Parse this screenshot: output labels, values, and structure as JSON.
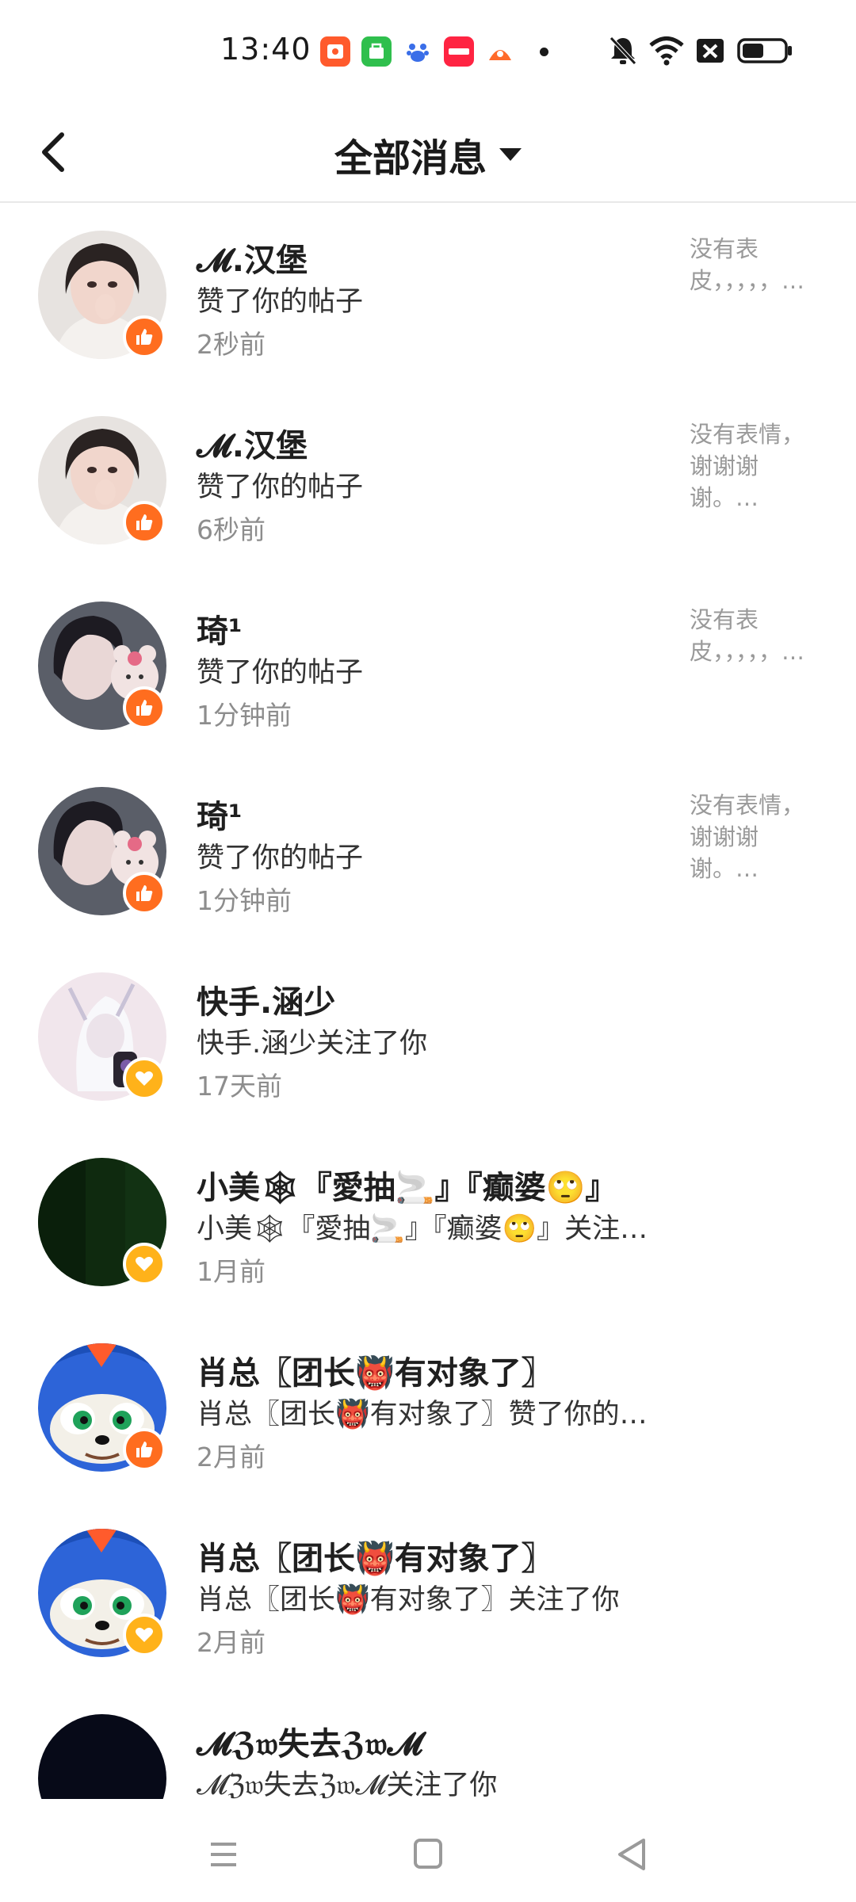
{
  "status_bar": {
    "time": "13:40",
    "notification_icons": [
      {
        "name": "kuaishou-app-icon",
        "color": "#ff5a2c",
        "text": "⊕"
      },
      {
        "name": "shopping-app-icon",
        "color": "#2fbf4d",
        "text": "✓"
      },
      {
        "name": "baidu-app-icon",
        "color": "#ffffff",
        "text": "du"
      },
      {
        "name": "xiaohongshu-app-icon",
        "color": "#ff2442",
        "text": "小红书"
      },
      {
        "name": "game-app-icon",
        "color": "#ff6a2a",
        "text": "●"
      }
    ],
    "battery_level": 0.45
  },
  "header": {
    "title": "全部消息"
  },
  "messages": [
    {
      "name": "𝓜.汉堡",
      "action": "赞了你的帖子",
      "time": "2秒前",
      "preview": "没有表皮，，，，，…",
      "badge": "like",
      "avatar": "girl-1"
    },
    {
      "name": "𝓜.汉堡",
      "action": "赞了你的帖子",
      "time": "6秒前",
      "preview": "没有表情，谢谢谢谢。…",
      "badge": "like",
      "avatar": "girl-1"
    },
    {
      "name": "琦¹",
      "action": "赞了你的帖子",
      "time": "1分钟前",
      "preview": "没有表皮，，，，，…",
      "badge": "like",
      "avatar": "girl-2"
    },
    {
      "name": "琦¹",
      "action": "赞了你的帖子",
      "time": "1分钟前",
      "preview": "没有表情，谢谢谢谢。…",
      "badge": "like",
      "avatar": "girl-2"
    },
    {
      "name": "快手.涵少",
      "action": "快手.涵少关注了你",
      "time": "17天前",
      "preview": "",
      "badge": "follow",
      "avatar": "anime"
    },
    {
      "name": "小美🕸『愛抽🚬』『癫婆🙄』",
      "action": "小美🕸『愛抽🚬』『癫婆🙄』关注…",
      "time": "1月前",
      "preview": "",
      "badge": "follow",
      "avatar": "dark-green"
    },
    {
      "name": "肖总〖团长👹有对象了〗",
      "action": "肖总〖团长👹有对象了〗赞了你的…",
      "time": "2月前",
      "preview": "",
      "badge": "like",
      "avatar": "sonic"
    },
    {
      "name": "肖总〖团长👹有对象了〗",
      "action": "肖总〖团长👹有对象了〗关注了你",
      "time": "2月前",
      "preview": "",
      "badge": "follow",
      "avatar": "sonic"
    },
    {
      "name": "𝓜ℨ𝔴失去ℨ𝔴𝓜",
      "action": "𝓜ℨ𝔴失去ℨ𝔴𝓜关注了你",
      "time": "",
      "preview": "",
      "badge": "none",
      "avatar": "black"
    }
  ],
  "colors": {
    "like_badge": "#ff6d1f",
    "follow_badge": "#ffb21a",
    "secondary_text": "#8d8d8d"
  }
}
